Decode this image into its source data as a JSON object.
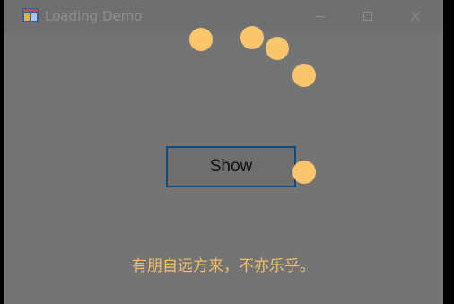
{
  "window": {
    "title": "Loading Demo",
    "icon": "winforms-app-icon"
  },
  "controls": {
    "minimize_icon": "minimize-icon",
    "maximize_icon": "maximize-icon",
    "close_icon": "close-icon"
  },
  "main": {
    "button_label": "Show",
    "caption": "有朋自远方来，不亦乐乎。"
  },
  "loading_indicator": {
    "icon": "loading-dots-spinner",
    "visible_dots": 5
  },
  "colors": {
    "overlay": "#747474",
    "dot": "#f9c66e",
    "caption": "#f2c06a",
    "button_border": "#0a4d7e"
  }
}
